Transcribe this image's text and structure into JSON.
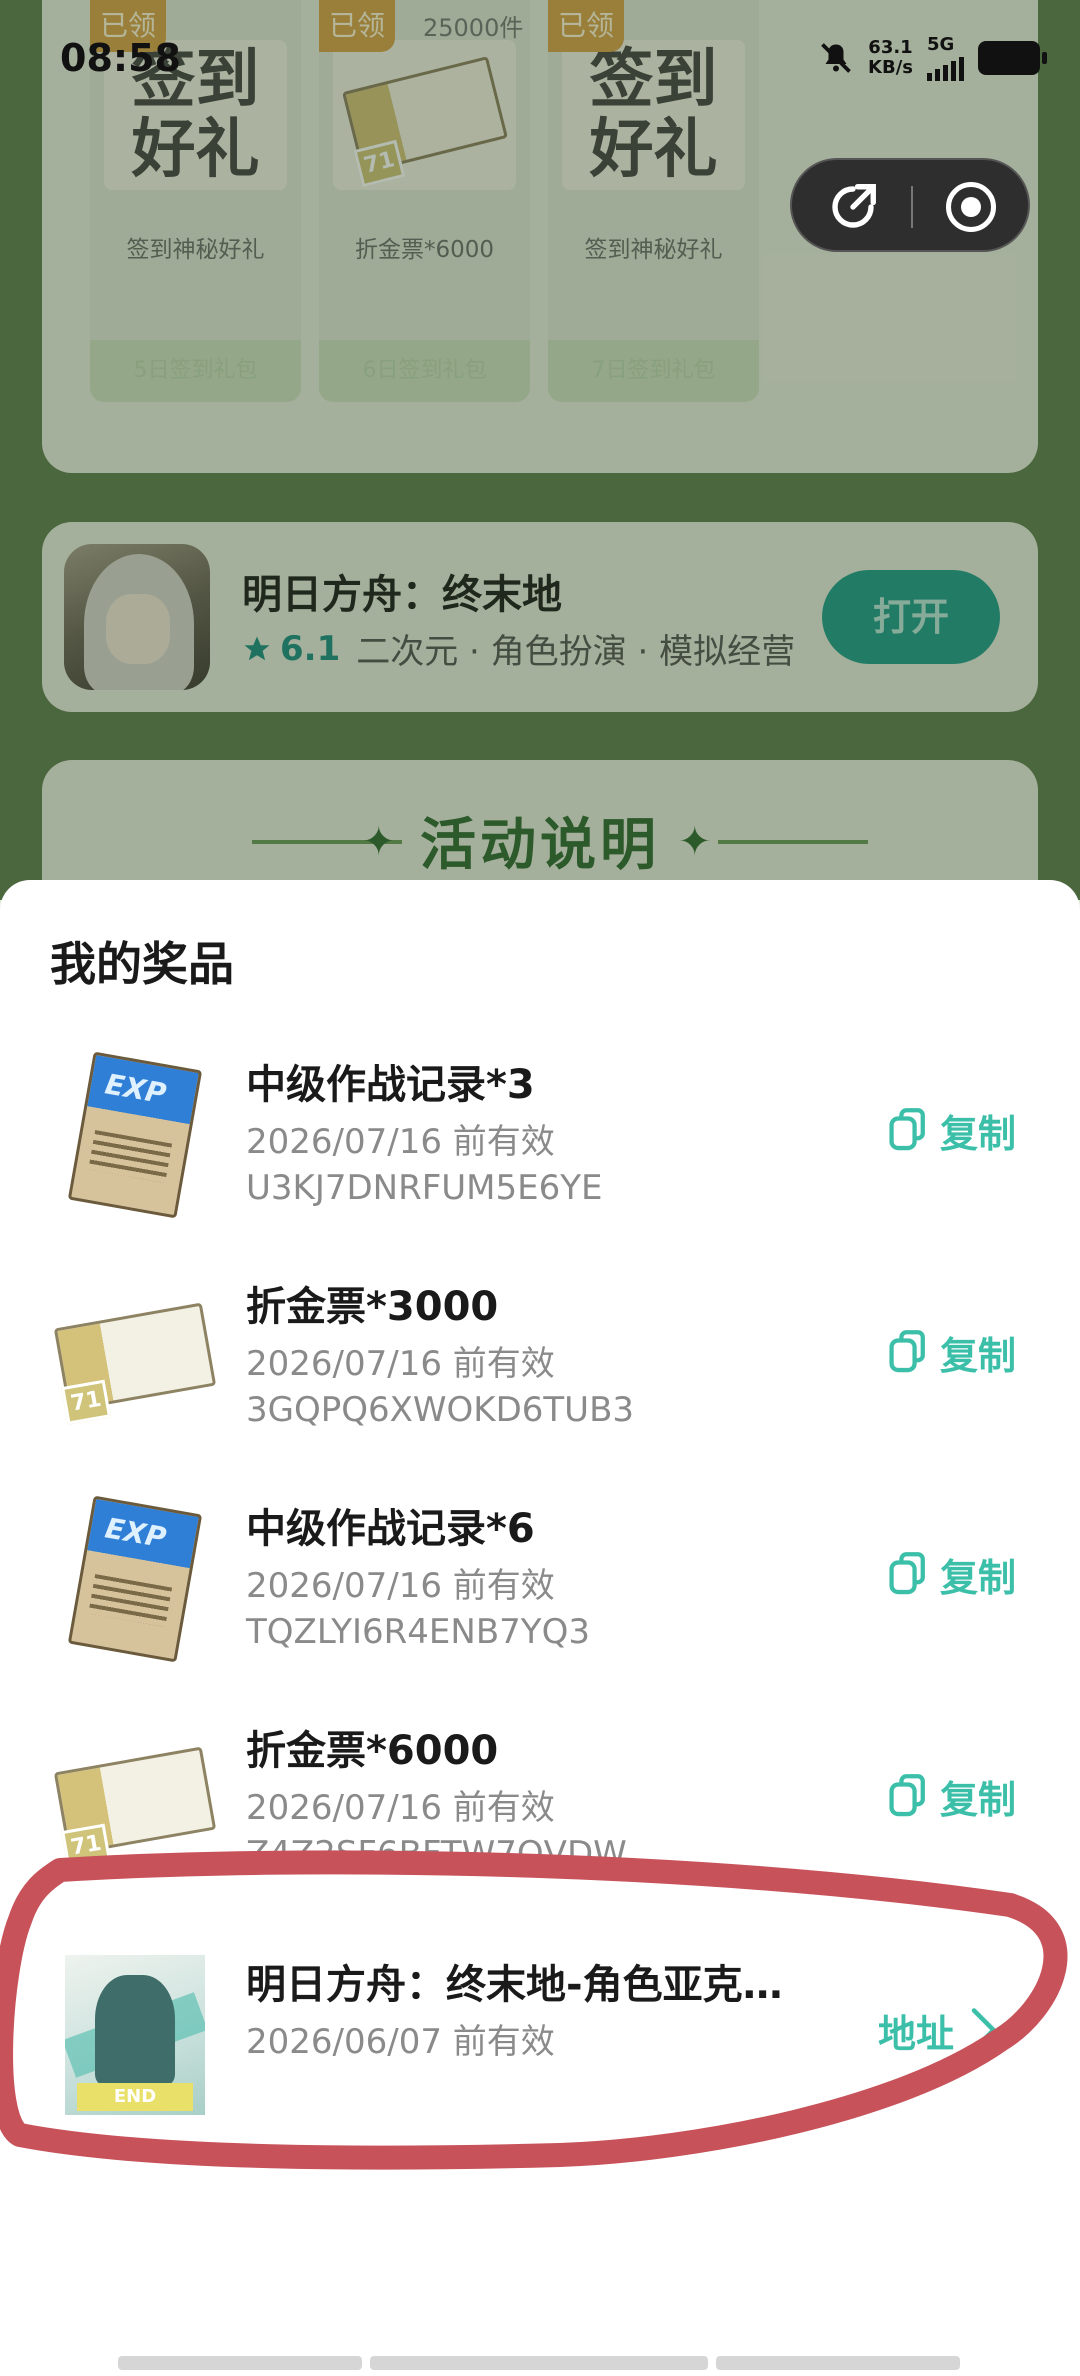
{
  "status_bar": {
    "time": "08:58",
    "speed_value": "63.1",
    "speed_unit": "KB/s",
    "network": "5G"
  },
  "background": {
    "rewards": [
      {
        "claimed": "已领",
        "stock": "",
        "art": "签到\n好礼",
        "name": "签到神秘好礼",
        "footer": "5日签到礼包"
      },
      {
        "claimed": "已领",
        "stock": "25000件",
        "art": "",
        "name": "折金票*6000",
        "footer": "6日签到礼包"
      },
      {
        "claimed": "已领",
        "stock": "",
        "art": "签到\n好礼",
        "name": "签到神秘好礼",
        "footer": "7日签到礼包"
      }
    ],
    "game": {
      "name": "明日方舟：终末地",
      "rating": "6.1",
      "tags": "二次元 · 角色扮演 · 模拟经营",
      "open_label": "打开"
    },
    "activity_title": "活动说明"
  },
  "sheet": {
    "title": "我的奖品",
    "copy_label": "复制",
    "address_label": "地址",
    "items": [
      {
        "name": "中级作战记录*3",
        "valid": "2026/07/16 前有效",
        "code": "U3KJ7DNRFUM5E6YE",
        "icon": "exp-record"
      },
      {
        "name": "折金票*3000",
        "valid": "2026/07/16 前有效",
        "code": "3GQPQ6XWOKD6TUB3",
        "icon": "ticket"
      },
      {
        "name": "中级作战记录*6",
        "valid": "2026/07/16 前有效",
        "code": "TQZLYI6R4ENB7YQ3",
        "icon": "exp-record"
      },
      {
        "name": "折金票*6000",
        "valid": "2026/07/16 前有效",
        "code": "Z4Z2SF6BFTW7QVDW",
        "icon": "ticket"
      },
      {
        "name": "明日方舟：终末地-角色亚克…",
        "valid": "2026/06/07 前有效",
        "icon": "character-card"
      }
    ]
  },
  "colors": {
    "accent": "#3cbfa9",
    "annotation": "#c8525a"
  }
}
